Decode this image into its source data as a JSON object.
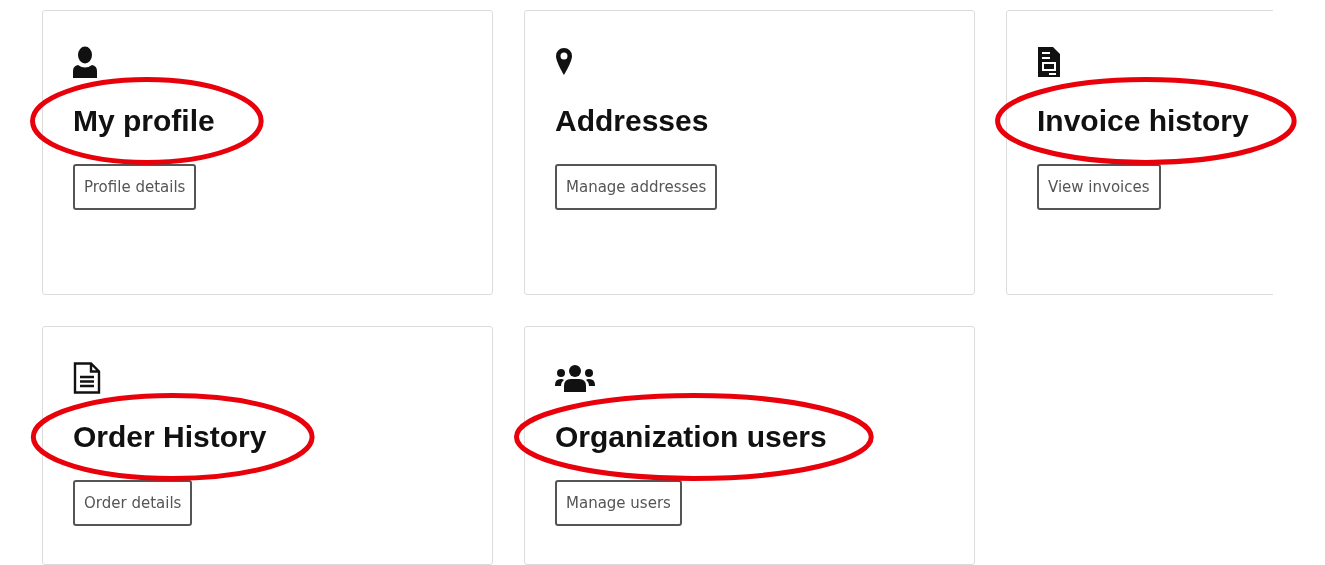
{
  "cards": [
    {
      "title": "My profile",
      "button": "Profile details",
      "highlighted": true
    },
    {
      "title": "Addresses",
      "button": "Manage addresses",
      "highlighted": false
    },
    {
      "title": "Invoice history",
      "button": "View invoices",
      "highlighted": true
    },
    {
      "title": "Order History",
      "button": "Order details",
      "highlighted": true
    },
    {
      "title": "Organization users",
      "button": "Manage users",
      "highlighted": true
    }
  ]
}
